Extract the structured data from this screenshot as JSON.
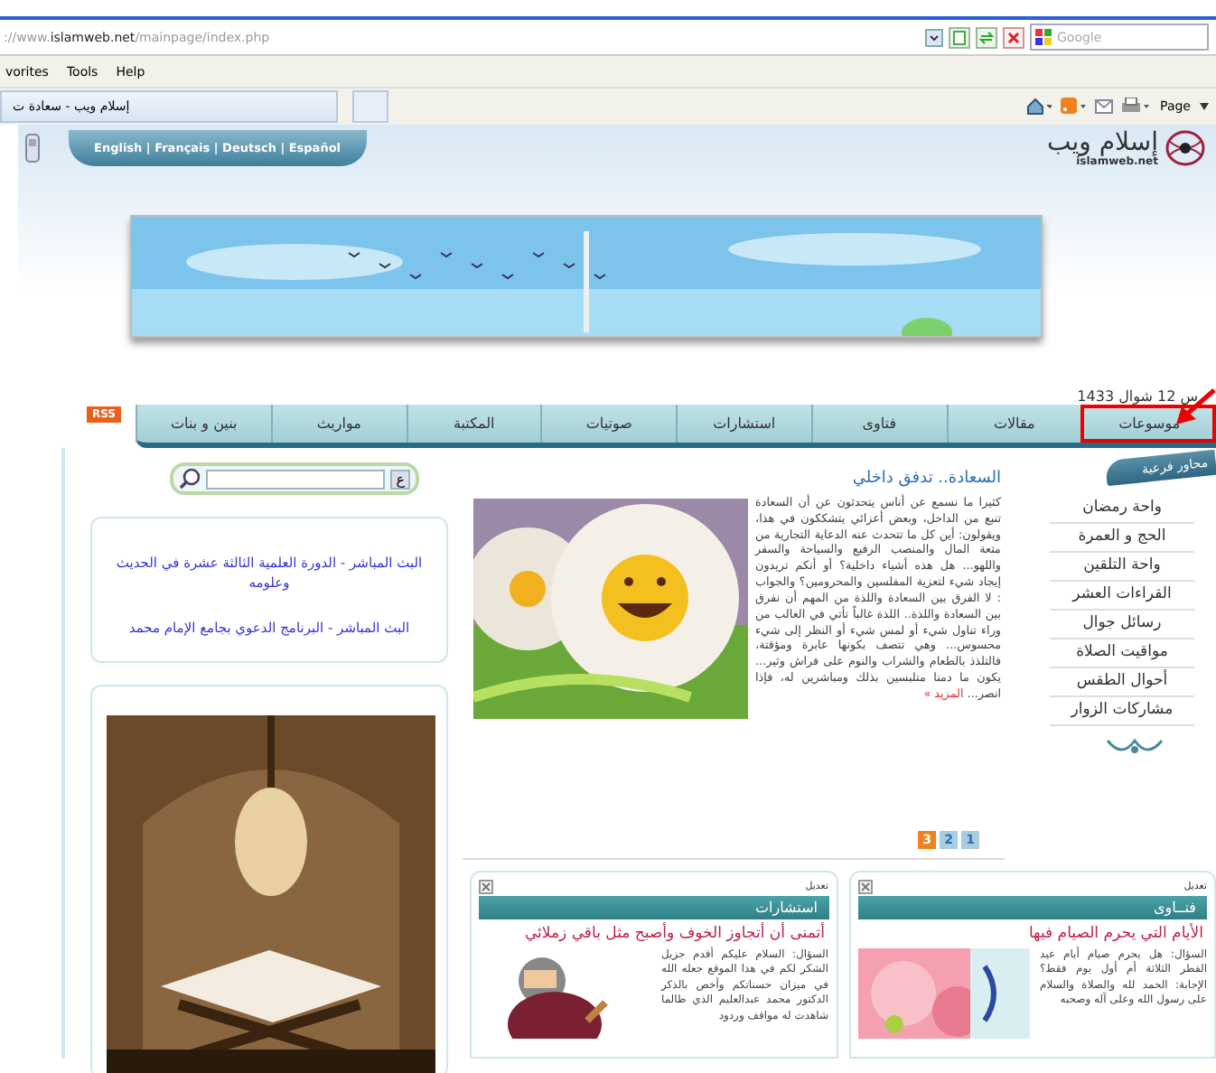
{
  "browser": {
    "address": "://www.**islamweb.net**/mainpage/index.php",
    "search_placeholder": "Google",
    "menu_favorites": "vorites",
    "menu_tools": "Tools",
    "menu_help": "Help",
    "tab_title": "إسلام ويب - سعادة ت",
    "page_menu": "Page"
  },
  "header": {
    "languages": "English | Français | Deutsch | Español",
    "logo_arabic": "إسلام ويب",
    "logo_latin": "islamweb.net",
    "date": "س 12 شوال 1433"
  },
  "nav": {
    "rss": "RSS",
    "tabs": [
      {
        "label": "موسوعات",
        "highlighted": true
      },
      {
        "label": "مقالات",
        "highlighted": false
      },
      {
        "label": "فتاوى",
        "highlighted": false
      },
      {
        "label": "استشارات",
        "highlighted": false
      },
      {
        "label": "صوتيات",
        "highlighted": false
      },
      {
        "label": "المكتبة",
        "highlighted": false
      },
      {
        "label": "مواريث",
        "highlighted": false
      },
      {
        "label": "بنين و بنات",
        "highlighted": false
      }
    ]
  },
  "search": {
    "button": "ع"
  },
  "live_links": [
    "البث المباشر - الدورة العلمية الثالثة عشرة في الحديث وعلومه",
    "البث المباشر - البرنامج الدعوي بجامع الإمام محمد"
  ],
  "article": {
    "title": "السعادة.. تدفق داخلي",
    "body": "كثيرا ما نسمع عن أناس يتحدثون عن أن السعادة تنبع من الداخل، وبعض أعزائي يتشككون في هذا، ويقولون: أين كل ما تتحدث عنه الدعاية التجارية من متعة المال والمنصب الرفيع والسياحة والسفر واللهو... هل هذه أشياء داخلية؟ أو أنكم تريدون إيجاد شيء لتعزية المفلسين والمحرومين؟ والجواب : لا الفرق بين السعادة واللذة من المهم أن نفرق بين السعادة واللذة.. اللذة غالباً تأتي في الغالب من وراء تناول شيء أو لمس شيء أو النظر إلى شيء محسوس... وهي تتصف بكونها عابرة ومؤقتة، فالتلذذ بالطعام والشراب والنوم على فراش وثير... يكون ما دمنا متلبسين بذلك ومباشرين له، فإذا انصر...",
    "more": "المزيد »",
    "pages": [
      {
        "label": "1",
        "selected": false
      },
      {
        "label": "2",
        "selected": false
      },
      {
        "label": "3",
        "selected": true
      }
    ]
  },
  "sidebar": {
    "title": "محاور فرعية",
    "items": [
      "واحة رمضان",
      "الحج و العمرة",
      "واحة التلقين",
      "القراءات العشر",
      "رسائل جوال",
      "مواقيت الصلاة",
      "أحوال الطقس",
      "مشاركات الزوار"
    ]
  },
  "panels": [
    {
      "edit": "تعديل",
      "heading": "فتــاوى",
      "title": "الأيام التي يحرم الصيام فيها",
      "text": "السؤال: هل يحرم صيام أيام عيد الفطر الثلاثة أم أول يوم فقط؟ الإجابة: الحمد لله والصلاة والسلام على رسول الله وعلى آله وصحبه"
    },
    {
      "edit": "تعديل",
      "heading": "استشارات",
      "title": "أتمنى أن أتجاوز الخوف وأصبح مثل باقي زملائي",
      "text": "السؤال: السلام عليكم أقدم جزيل الشكر لكم في هذا الموقع جعله الله في ميزان حسناتكم وأخص بالذكر الدكتور محمد عبدالعليم الذي طالما شاهدت له مواقف وردود"
    }
  ]
}
